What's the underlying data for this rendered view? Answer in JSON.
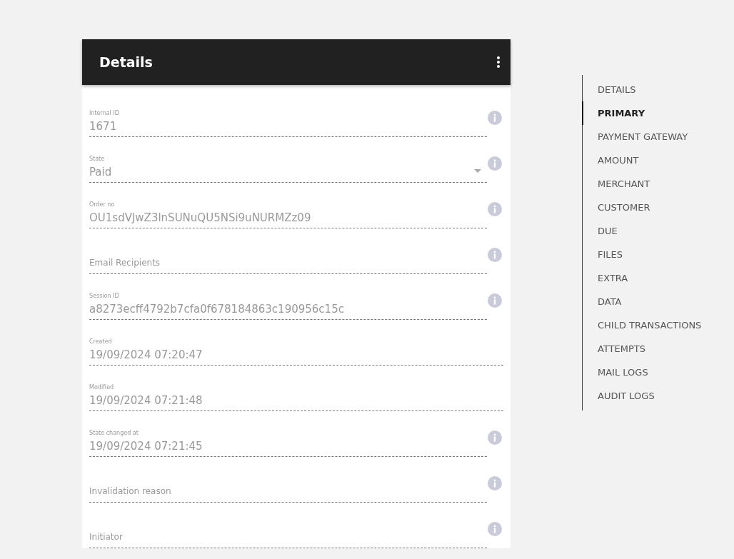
{
  "card": {
    "title": "Details"
  },
  "fields": [
    {
      "kind": "text",
      "label": "Internal ID",
      "value": "1671",
      "info": true
    },
    {
      "kind": "select",
      "label": "State",
      "value": "Paid",
      "info": true
    },
    {
      "kind": "text",
      "label": "Order no",
      "value": "OU1sdVJwZ3lnSUNuQU5NSi9uNURMZz09",
      "info": true
    },
    {
      "kind": "text",
      "placeholder": "Email Recipients",
      "info": true
    },
    {
      "kind": "text",
      "label": "Session ID",
      "value": "a8273ecff4792b7cfa0f678184863c190956c15c",
      "info": true
    },
    {
      "kind": "text",
      "label": "Created",
      "value": "19/09/2024 07:20:47",
      "info": false
    },
    {
      "kind": "text",
      "label": "Modified",
      "value": "19/09/2024 07:21:48",
      "info": false
    },
    {
      "kind": "text",
      "label": "State changed at",
      "value": "19/09/2024 07:21:45",
      "info": true
    },
    {
      "kind": "text",
      "placeholder": "Invalidation reason",
      "info": true
    },
    {
      "kind": "text",
      "placeholder": "Initiator",
      "info": true
    }
  ],
  "nav": [
    {
      "label": "DETAILS",
      "selected": false
    },
    {
      "label": "PRIMARY",
      "selected": true
    },
    {
      "label": "PAYMENT GATEWAY",
      "selected": false
    },
    {
      "label": "AMOUNT",
      "selected": false
    },
    {
      "label": "MERCHANT",
      "selected": false
    },
    {
      "label": "CUSTOMER",
      "selected": false
    },
    {
      "label": "DUE",
      "selected": false
    },
    {
      "label": "FILES",
      "selected": false
    },
    {
      "label": "EXTRA",
      "selected": false
    },
    {
      "label": "DATA",
      "selected": false
    },
    {
      "label": "CHILD TRANSACTIONS",
      "selected": false
    },
    {
      "label": "ATTEMPTS",
      "selected": false
    },
    {
      "label": "MAIL LOGS",
      "selected": false
    },
    {
      "label": "AUDIT LOGS",
      "selected": false
    }
  ]
}
